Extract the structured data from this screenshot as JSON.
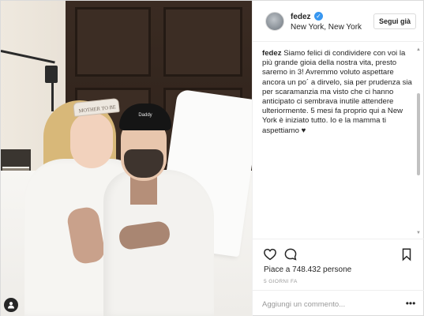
{
  "post": {
    "username": "fedez",
    "verified_mark": "✓",
    "location": "New York, New York",
    "follow_label": "Segui già",
    "caption_user": "fedez",
    "caption_text": "Siamo felici di condividere con voi la più grande gioia della nostra vita, presto saremo in 3! Avremmo voluto aspettare ancora un po´ a dirvelo, sia per prudenza sia per scaramanzia ma visto che ci hanno anticipato ci sembrava inutile attendere ulteriormente. 5 mesi fa proprio qui a New York è iniziato tutto. Io e la mamma ti aspettiamo ♥",
    "likes": "Piace a 748.432 persone",
    "time_ago": "5 GIORNI FA",
    "comment_placeholder": "Aggiungi un commento...",
    "more_glyph": "•••"
  },
  "photo": {
    "crown_text": "MOTHER TO BE",
    "cap_text": "Daddy"
  },
  "icons": {
    "like": "heart-icon",
    "comment": "comment-icon",
    "save": "bookmark-icon",
    "options": "more-options-icon",
    "tagged": "user-tag-icon"
  }
}
